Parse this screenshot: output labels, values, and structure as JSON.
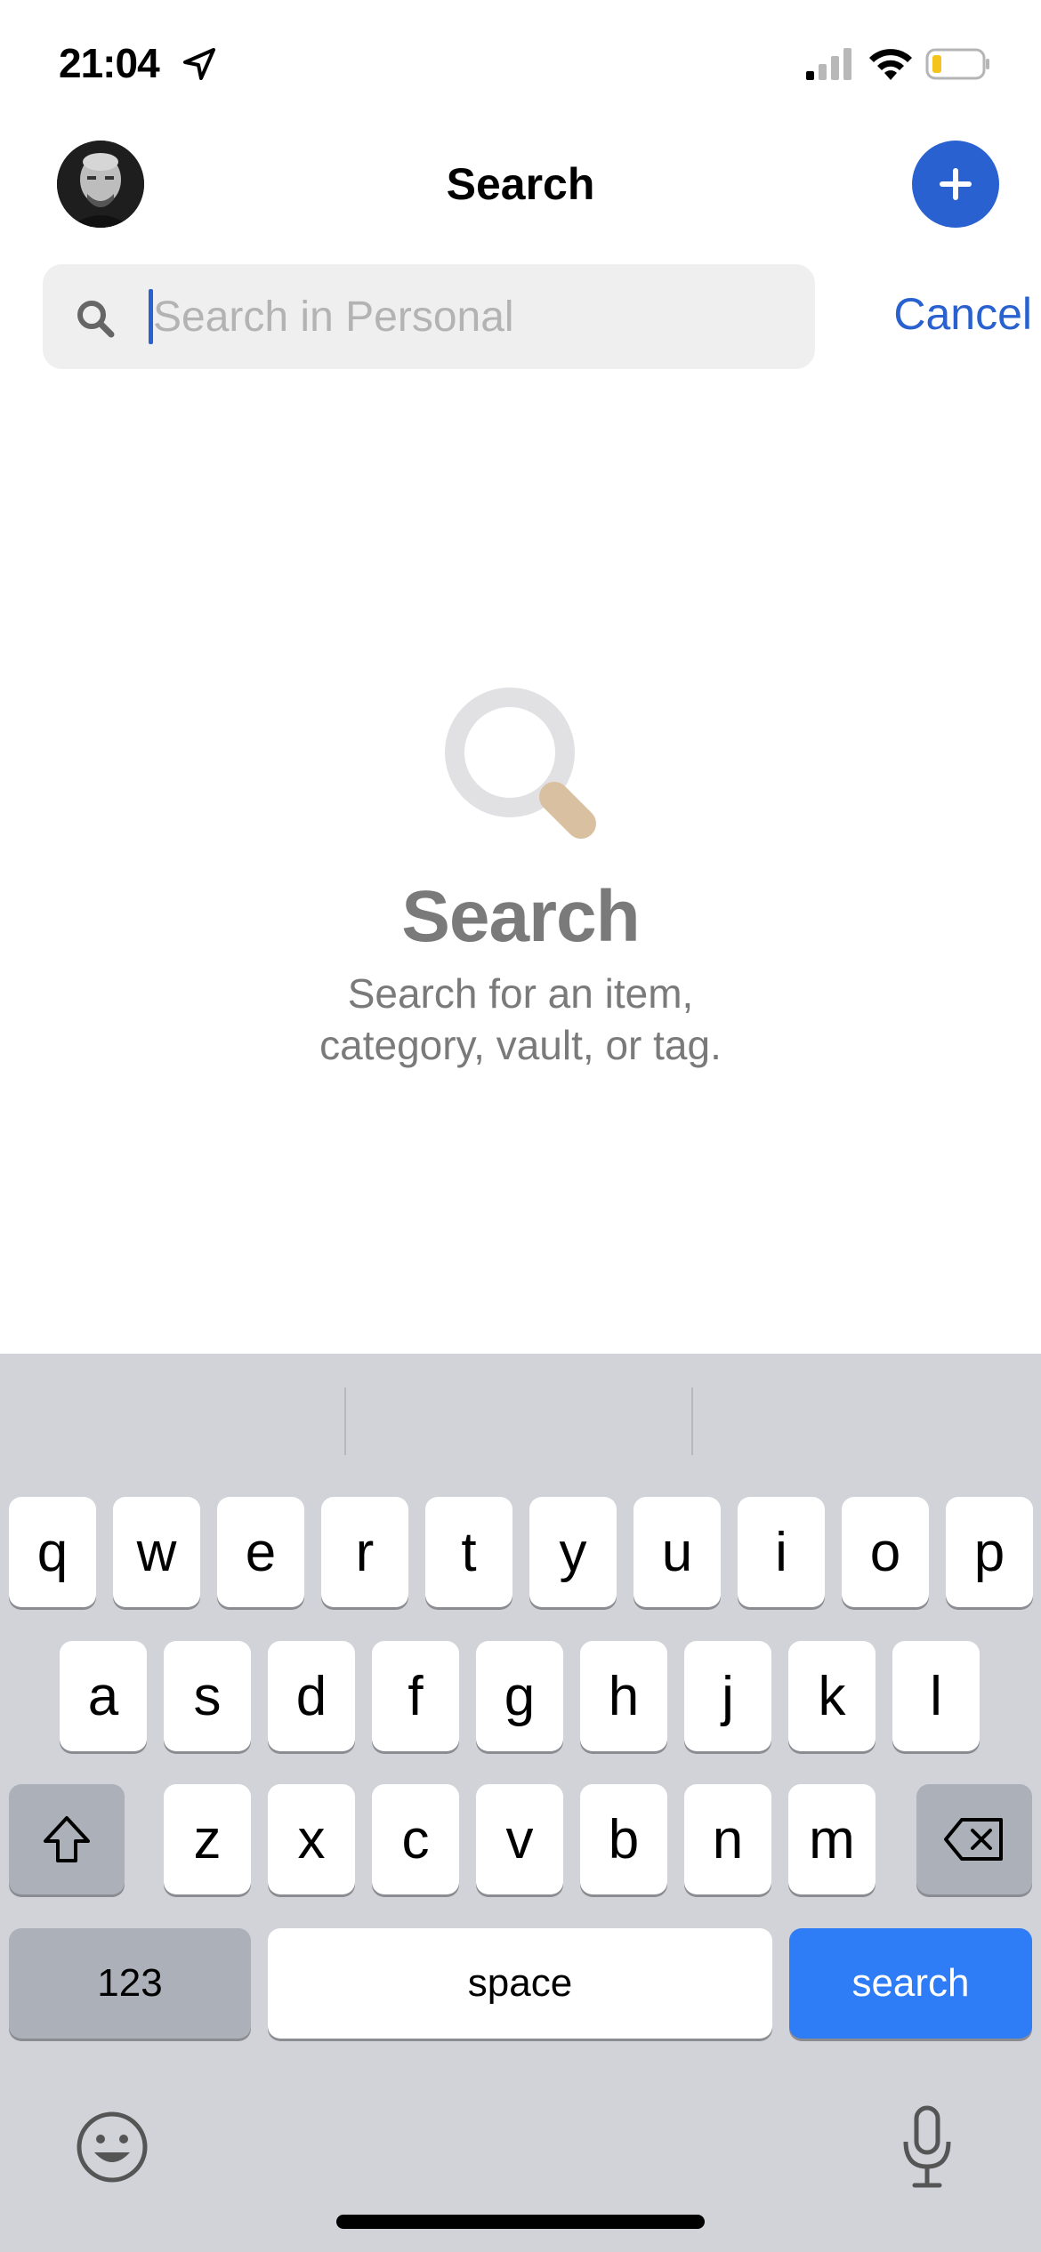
{
  "status_bar": {
    "time": "21:04"
  },
  "nav": {
    "title": "Search"
  },
  "search": {
    "placeholder": "Search in Personal",
    "value": "",
    "cancel_label": "Cancel"
  },
  "empty_state": {
    "title": "Search",
    "line1": "Search for an item,",
    "line2": "category, vault, or tag."
  },
  "keyboard": {
    "row1": [
      "q",
      "w",
      "e",
      "r",
      "t",
      "y",
      "u",
      "i",
      "o",
      "p"
    ],
    "row2": [
      "a",
      "s",
      "d",
      "f",
      "g",
      "h",
      "j",
      "k",
      "l"
    ],
    "row3": [
      "z",
      "x",
      "c",
      "v",
      "b",
      "n",
      "m"
    ],
    "numbers_label": "123",
    "space_label": "space",
    "search_label": "search"
  },
  "colors": {
    "accent": "#2961d1",
    "keyboard_search": "#2e7cf6",
    "keyboard_bg": "#d1d3d9"
  },
  "icons": [
    "location-arrow-icon",
    "signal-icon",
    "wifi-icon",
    "battery-icon",
    "plus-icon",
    "search-icon",
    "magnifier-illustration",
    "shift-icon",
    "backspace-icon",
    "emoji-icon",
    "microphone-icon"
  ]
}
